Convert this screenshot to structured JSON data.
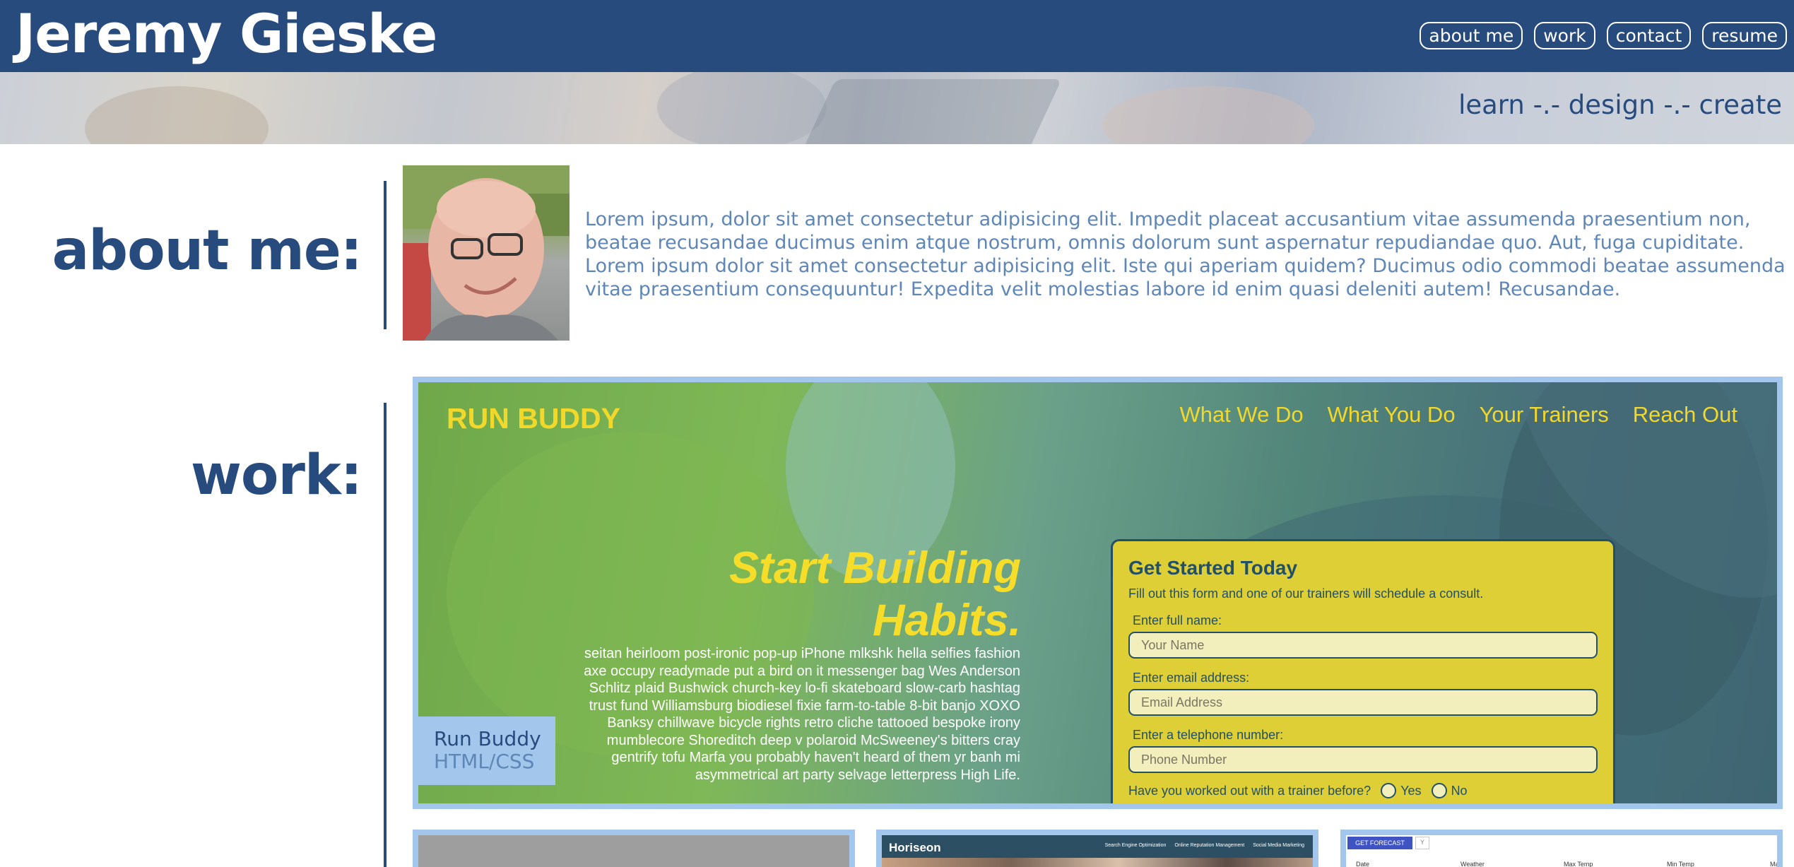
{
  "header": {
    "title": "Jeremy Gieske",
    "nav": [
      "about me",
      "work",
      "contact",
      "resume"
    ]
  },
  "banner": {
    "tagline": "learn -.- design -.- create"
  },
  "about": {
    "label": "about me:",
    "text": "Lorem ipsum, dolor sit amet consectetur adipisicing elit. Impedit placeat accusantium vitae assumenda praesentium non, beatae recusandae ducimus enim atque nostrum, omnis dolorum sunt aspernatur repudiandae quo. Aut, fuga cupiditate. Lorem ipsum dolor sit amet consectetur adipisicing elit. Iste qui aperiam quidem? Ducimus odio commodi beatae assumenda vitae praesentium consequuntur! Expedita velit molestias labore id enim quasi deleniti autem! Recusandae."
  },
  "work": {
    "label": "work:",
    "featured": {
      "name": "Run Buddy",
      "tech": "HTML/CSS",
      "preview": {
        "brand": "RUN BUDDY",
        "nav": [
          "What We Do",
          "What You Do",
          "Your Trainers",
          "Reach Out"
        ],
        "hero": "Start Building Habits.",
        "body": "seitan heirloom post-ironic pop-up iPhone mlkshk hella selfies fashion axe occupy readymade put a bird on it messenger bag Wes Anderson Schlitz plaid Bushwick church-key lo-fi skateboard slow-carb hashtag trust fund Williamsburg biodiesel fixie farm-to-table 8-bit banjo XOXO Banksy chillwave bicycle rights retro cliche tattooed bespoke irony mumblecore Shoreditch deep v polaroid McSweeney's bitters cray gentrify tofu Marfa you probably haven't heard of them yr banh mi asymmetrical art party selvage letterpress High Life.",
        "form": {
          "title": "Get Started Today",
          "subtitle": "Fill out this form and one of our trainers will schedule a consult.",
          "name_label": "Enter full name:",
          "name_placeholder": "Your Name",
          "email_label": "Enter email address:",
          "email_placeholder": "Email Address",
          "phone_label": "Enter a telephone number:",
          "phone_placeholder": "Phone Number",
          "question": "Have you worked out with a trainer before?",
          "yes": "Yes",
          "no": "No"
        }
      }
    },
    "thumbs": {
      "horiseon": {
        "brand": "Horiseon",
        "nav": [
          "Search Engine Optimization",
          "Online Reputation Management",
          "Social Media Marketing"
        ]
      },
      "forecast": {
        "button": "GET FORECAST",
        "dropdown": "Y",
        "columns": [
          "Date",
          "Weather",
          "Max Temp",
          "Min Temp",
          "Max Wind Speed"
        ]
      }
    }
  },
  "colors": {
    "primary": "#284b7d",
    "accent_light": "#a3c7ec",
    "text_muted": "#5e86b6",
    "runbuddy_yellow": "#f2d82a"
  }
}
